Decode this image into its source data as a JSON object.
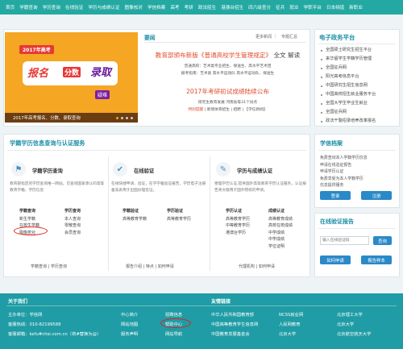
{
  "nav": [
    "首页",
    "学籍查询",
    "学历查询",
    "在线验证",
    "学历与成绩认证",
    "图像校对",
    "学信档案",
    "高考",
    "考研",
    "政法招生",
    "港澳台招生",
    "四六级查分",
    "征兵",
    "就业",
    "学职平台",
    "日本频道",
    "新职业"
  ],
  "banner": {
    "year": "2017年高考",
    "word1": "报名",
    "word2": "分数",
    "word3": "录取",
    "question": "疑难",
    "caption": "2017年高考报名、分数、录取查询"
  },
  "news": {
    "title": "要闻",
    "more": "更多新闻",
    "zhuanti": "专题汇总",
    "headline1": "教育部颁布新版《普通高校学生管理规定》",
    "headline1_tail": "全文",
    "headline1_link": "解读",
    "sub1a": "普通高校：艺术类专业招生、保送生、高水平艺术团",
    "sub1b": "报考指南：艺术类  高水平运动队  高水平运动队、保送生",
    "headline2": "2017年考研初试成绩陆续公布",
    "sub2a": "研究生教育发展  河南省等31个试点",
    "sub2b_link": "特别提醒",
    "sub2b_rest": "| 新增体育招生 | 招聘 | 【学信新闻】"
  },
  "egov": {
    "title": "电子政务平台",
    "items": [
      "全国硕士研究生招生平台",
      "来华留学生学籍学历管理",
      "全国征兵网",
      "阳光高考信息平台",
      "中国研究生招生信息网",
      "中国高校招生就业服务平台",
      "全国大学生毕业生就业",
      "全国征兵网",
      "政法干警招录培养改革报名"
    ]
  },
  "services": {
    "title": "学籍学历信息查询与认证服务",
    "card1": {
      "title": "学籍学历查询",
      "desc": "教育部指定的学历查询唯一网站，可查询国家承认的高等教育学籍、学历信息",
      "col1_head": "学籍查询",
      "col1": [
        "新生学籍",
        "在校生学籍",
        "图像校对"
      ],
      "col2_head": "学历查询",
      "col2": [
        "本人查询",
        "零散查询",
        "会员查询"
      ],
      "links": "学籍查询  |  学历查询"
    },
    "card2": {
      "title": "在线验证",
      "desc": "在线快捷申请、验证，在学学籍验证报告，学历电子注册备案表用于出国办理签证。",
      "col1_head": "学籍验证",
      "col1": [
        "高等教育学籍"
      ],
      "col2_head": "学历验证",
      "col2": [
        "高等教育学历"
      ],
      "links": "报告介绍  |  特点  |  如何申请"
    },
    "card3": {
      "title": "学历与成绩认证",
      "desc": "受理学历认证,提供国外高等教育学历认证服务，认证报告英文版用于国外院校的申请。",
      "col1_head": "学历认证",
      "col1": [
        "高等教育学历",
        "中等教育学历",
        "港澳台学历"
      ],
      "col2_head": "成绩认证",
      "col2": [
        "高等教育成绩",
        "高校在校成绩",
        "中学成绩",
        "中学成绩",
        "学位证明"
      ],
      "links": "代理机构  |  如何申请"
    }
  },
  "archive": {
    "title": "学信档案",
    "lines": [
      "免费查询本人学籍学历信息",
      "申请在线验证报告",
      "申请学历认证",
      "免费享受为本人学籍学历",
      "信息提供服务"
    ],
    "login": "登录",
    "register": "注册"
  },
  "verify": {
    "title": "在线验证报告",
    "placeholder": "输入在线验证码",
    "query": "查询",
    "how_apply": "如何申请",
    "sample": "报告样本"
  },
  "footer": {
    "about_title": "关于我们",
    "links_title": "友情链接",
    "info": [
      "主办单位：学信网",
      "客服热线：010-82199588",
      "客服邮箱：kefu#chsi.com.cn（将#替换为@）"
    ],
    "col_a": [
      "中心简介",
      "网站地图",
      "服务声明"
    ],
    "col_b": [
      "招聘信息",
      "帮助中心",
      "网站导航"
    ],
    "friend_1": [
      "中华人民共和国教育部",
      "中国高等教育学生信息网",
      "中国教育发展基金会"
    ],
    "friend_2": [
      "NCSS就业网",
      "人民网教育",
      "北京大学"
    ],
    "friend_3": [
      "北京理工大学",
      "北京大学",
      "北京航空航天大学"
    ]
  },
  "colors": {
    "nav": "#23a9a2",
    "accent": "#1f8fa8",
    "headline": "#e04b2b",
    "button": "#2a89c7",
    "footer": "#1f9ca5",
    "highlight_circle": "#e02020"
  }
}
